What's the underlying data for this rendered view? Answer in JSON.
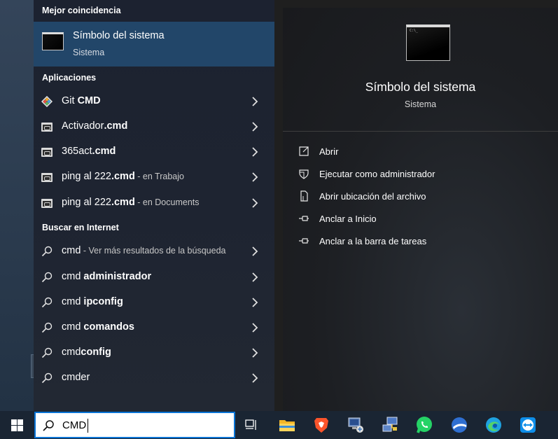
{
  "search_panel": {
    "best_match": {
      "section_label": "Mejor coincidencia",
      "title": "Símbolo del sistema",
      "subtitle": "Sistema",
      "icon": "cmd-icon"
    },
    "apps": {
      "section_label": "Aplicaciones",
      "items": [
        {
          "prefix": "Git ",
          "bold": "CMD",
          "suffix": "",
          "hint": "",
          "icon": "git-icon"
        },
        {
          "prefix": "Activador",
          "bold": ".cmd",
          "suffix": "",
          "hint": "",
          "icon": "cmd-file-icon"
        },
        {
          "prefix": "365act",
          "bold": ".cmd",
          "suffix": "",
          "hint": "",
          "icon": "cmd-file-icon"
        },
        {
          "prefix": "ping al 222",
          "bold": ".cmd",
          "suffix": "",
          "hint": " - en Trabajo",
          "icon": "cmd-file-icon"
        },
        {
          "prefix": "ping al 222",
          "bold": ".cmd",
          "suffix": "",
          "hint": " - en Documents",
          "icon": "cmd-file-icon"
        }
      ]
    },
    "web": {
      "section_label": "Buscar en Internet",
      "items": [
        {
          "prefix": "cmd",
          "bold": "",
          "hint": " - Ver más resultados de la búsqueda",
          "icon": "search-icon"
        },
        {
          "prefix": "cmd ",
          "bold": "administrador",
          "hint": "",
          "icon": "search-icon"
        },
        {
          "prefix": "cmd ",
          "bold": "ipconfig",
          "hint": "",
          "icon": "search-icon"
        },
        {
          "prefix": "cmd ",
          "bold": "comandos",
          "hint": "",
          "icon": "search-icon"
        },
        {
          "prefix": "cmd",
          "bold": "config",
          "hint": "",
          "icon": "search-icon"
        },
        {
          "prefix": "cmder",
          "bold": "",
          "hint": "",
          "icon": "search-icon"
        }
      ]
    }
  },
  "detail": {
    "title": "Símbolo del sistema",
    "subtitle": "Sistema",
    "actions": [
      {
        "label": "Abrir",
        "icon": "open-icon"
      },
      {
        "label": "Ejecutar como administrador",
        "icon": "shield-icon"
      },
      {
        "label": "Abrir ubicación del archivo",
        "icon": "file-location-icon"
      },
      {
        "label": "Anclar a Inicio",
        "icon": "pin-icon"
      },
      {
        "label": "Anclar a la barra de tareas",
        "icon": "pin-icon"
      }
    ]
  },
  "taskbar": {
    "search_value": "CMD",
    "icons": [
      "task-view-icon",
      "file-explorer-icon",
      "brave-icon",
      "network-computer-icon",
      "network-computer-icon",
      "whatsapp-icon",
      "app-globe-icon",
      "edge-icon",
      "teamviewer-icon"
    ]
  },
  "colors": {
    "selection": "#224669",
    "search_border": "#0a74d6",
    "taskbar": "#1a2533"
  }
}
